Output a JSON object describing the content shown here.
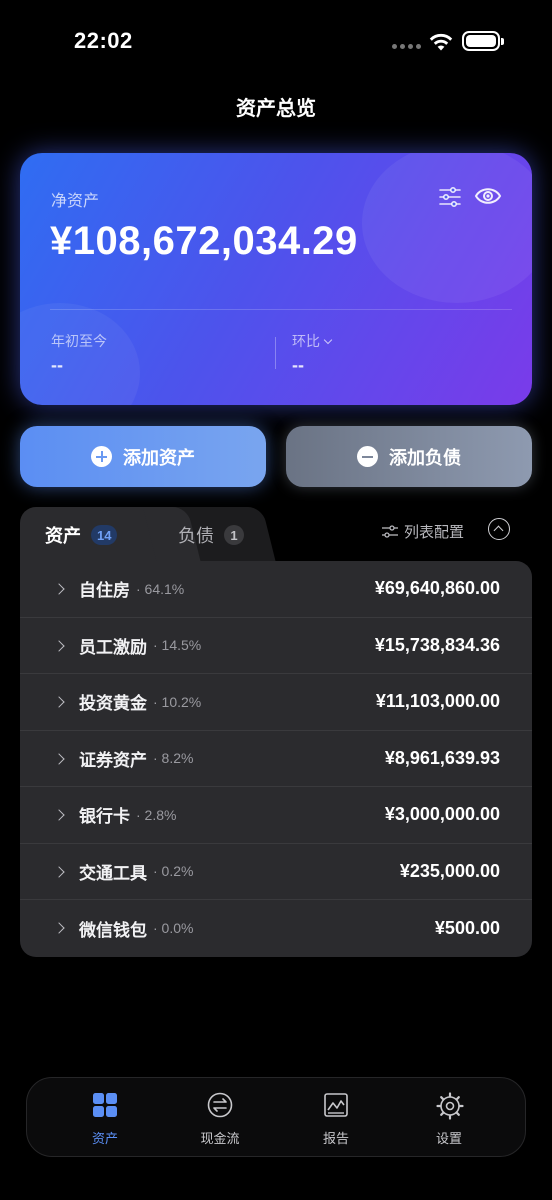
{
  "status_bar": {
    "time": "22:02"
  },
  "page": {
    "title": "资产总览"
  },
  "net_worth_card": {
    "label": "净资产",
    "amount": "¥108,672,034.29",
    "ytd_label": "年初至今",
    "ytd_value": "--",
    "mom_label": "环比",
    "mom_value": "--"
  },
  "actions": {
    "add_asset": "添加资产",
    "add_liability": "添加负债"
  },
  "tabs": {
    "assets": {
      "label": "资产",
      "count": "14"
    },
    "liabilities": {
      "label": "负债",
      "count": "1"
    },
    "list_config": "列表配置"
  },
  "asset_rows": [
    {
      "name": "自住房",
      "pct": "· 64.1%",
      "value": "¥69,640,860.00"
    },
    {
      "name": "员工激励",
      "pct": "· 14.5%",
      "value": "¥15,738,834.36"
    },
    {
      "name": "投资黄金",
      "pct": "· 10.2%",
      "value": "¥11,103,000.00"
    },
    {
      "name": "证券资产",
      "pct": "· 8.2%",
      "value": "¥8,961,639.93"
    },
    {
      "name": "银行卡",
      "pct": "· 2.8%",
      "value": "¥3,000,000.00"
    },
    {
      "name": "交通工具",
      "pct": "· 0.2%",
      "value": "¥235,000.00"
    },
    {
      "name": "微信钱包",
      "pct": "· 0.0%",
      "value": "¥500.00"
    }
  ],
  "nav": {
    "items": [
      {
        "label": "资产",
        "icon": "grid-icon",
        "active": true
      },
      {
        "label": "现金流",
        "icon": "exchange-icon",
        "active": false
      },
      {
        "label": "报告",
        "icon": "chart-icon",
        "active": false
      },
      {
        "label": "设置",
        "icon": "gear-icon",
        "active": false
      }
    ]
  },
  "colors": {
    "accent": "#5b8ff5",
    "card_gradient_start": "#2f6df2",
    "card_gradient_end": "#7a3bea",
    "background": "#000000",
    "list_background": "#2b2b2e"
  }
}
